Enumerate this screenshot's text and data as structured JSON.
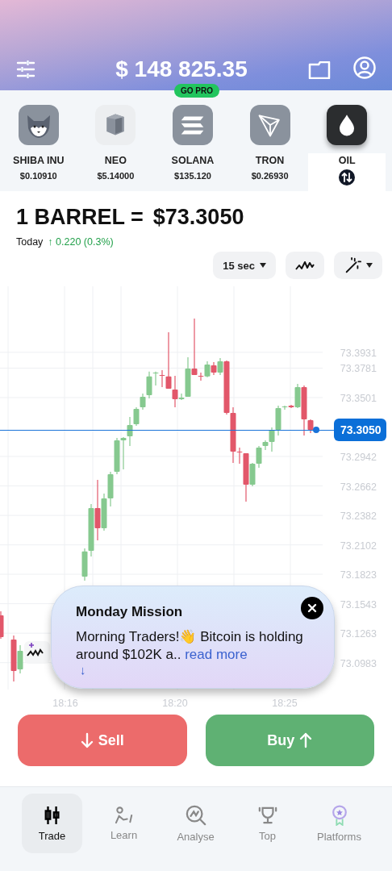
{
  "header": {
    "balance": "$ 148 825.35",
    "badge": "GO PRO"
  },
  "assets": [
    {
      "name": "SHIBA INU",
      "price": "$0.10910",
      "selected": false
    },
    {
      "name": "NEO",
      "price": "$5.14000",
      "selected": false
    },
    {
      "name": "SOLANA",
      "price": "$135.120",
      "selected": false
    },
    {
      "name": "TRON",
      "price": "$0.26930",
      "selected": false
    },
    {
      "name": "OIL",
      "selected": true
    }
  ],
  "quote": {
    "unit": "1 BARREL =",
    "price": "$73.3050",
    "period": "Today",
    "change": "↑ 0.220 (0.3%)"
  },
  "controls": {
    "interval": "15 sec"
  },
  "chart": {
    "current_price": "73.3050",
    "chart_data": {
      "type": "candlestick",
      "categories": [
        null,
        null,
        null,
        null,
        null,
        null,
        null,
        null,
        null,
        null,
        "18:16",
        null,
        null,
        null,
        null,
        null,
        null,
        null,
        null,
        null,
        null,
        null,
        null,
        null,
        null,
        null,
        null,
        "18:20",
        null,
        null,
        null,
        null,
        null,
        null,
        null,
        null,
        null,
        null,
        null,
        null,
        null,
        null,
        null,
        null,
        "18:25",
        null,
        null,
        null,
        null
      ],
      "ohlc": [
        [
          73.1433,
          73.1471,
          73.1211,
          73.1226
        ],
        null,
        [
          73.1203,
          73.1241,
          73.0805,
          73.0904
        ],
        [
          73.092,
          73.1149,
          73.0881,
          73.1096
        ],
        null,
        null,
        null,
        null,
        null,
        null,
        null,
        null,
        null,
        [
          73.18,
          73.2069,
          73.1762,
          73.2039
        ],
        [
          73.2046,
          73.249,
          73.1992,
          73.2452
        ],
        [
          73.2452,
          73.272,
          73.2145,
          73.226
        ],
        [
          73.226,
          73.2589,
          73.2237,
          73.2543
        ],
        [
          73.2543,
          73.2796,
          73.2467,
          73.2773
        ],
        [
          73.2796,
          73.3118,
          73.2773,
          73.3095
        ],
        [
          73.3095,
          73.3126,
          73.2819,
          73.3118
        ],
        [
          73.3133,
          73.3317,
          73.3041,
          73.3241
        ],
        [
          73.3248,
          73.3409,
          73.3233,
          73.3394
        ],
        [
          73.3409,
          73.3539,
          73.3386,
          73.3509
        ],
        [
          73.3524,
          73.3748,
          73.3493,
          73.3702
        ],
        [
          73.3731,
          73.3748,
          73.3616,
          73.3738
        ],
        [
          73.3715,
          73.3761,
          73.3601,
          73.3708
        ],
        [
          73.3702,
          73.4121,
          73.3585,
          73.3585
        ],
        [
          73.3578,
          73.3708,
          73.3409,
          73.3486
        ],
        [
          73.3486,
          73.3539,
          73.3478,
          73.3501
        ],
        [
          73.3509,
          73.3884,
          73.3509,
          73.3777
        ],
        [
          73.3777,
          73.4252,
          73.3715,
          73.3715
        ],
        [
          73.3708,
          73.3738,
          73.3662,
          73.3702
        ],
        [
          73.3702,
          73.3846,
          73.3694,
          73.3815
        ],
        [
          73.3807,
          73.3838,
          73.3715,
          73.3738
        ],
        [
          73.3738,
          73.3876,
          73.3715,
          73.3846
        ],
        [
          73.3846,
          73.3853,
          73.334,
          73.3355
        ],
        [
          73.3355,
          73.3409,
          73.2881,
          73.2988
        ],
        [
          73.2988,
          73.3026,
          73.2873,
          73.298
        ],
        [
          73.2972,
          73.2972,
          73.2513,
          73.2674
        ],
        [
          73.2674,
          73.2881,
          73.2659,
          73.2873
        ],
        [
          73.2873,
          73.3041,
          73.2835,
          73.3026
        ],
        [
          73.3041,
          73.3095,
          73.3003,
          73.308
        ],
        [
          73.308,
          73.3218,
          73.2988,
          73.3195
        ],
        [
          73.3195,
          73.3424,
          73.3141,
          73.3401
        ],
        [
          73.3409,
          73.3424,
          73.3386,
          73.3417
        ],
        [
          73.3424,
          73.3432,
          73.3401,
          73.3409
        ],
        [
          73.3409,
          73.3631,
          73.3401,
          73.3601
        ],
        [
          73.3601,
          73.3616,
          73.3141,
          73.3294
        ],
        [
          73.3286,
          73.3294,
          73.3164,
          73.3195
        ]
      ],
      "yticks": [
        {
          "value": 73.3931,
          "label": "73.3931"
        },
        {
          "value": 73.3781,
          "label": "73.3781"
        },
        {
          "value": 73.3501,
          "label": "73.3501"
        },
        {
          "value": 73.2942,
          "label": "73.2942"
        },
        {
          "value": 73.2662,
          "label": "73.2662"
        },
        {
          "value": 73.2382,
          "label": "73.2382"
        },
        {
          "value": 73.2102,
          "label": "73.2102"
        },
        {
          "value": 73.1823,
          "label": "73.1823"
        },
        {
          "value": 73.1543,
          "label": "73.1543"
        },
        {
          "value": 73.1263,
          "label": "73.1263"
        },
        {
          "value": 73.0983,
          "label": "73.0983"
        }
      ],
      "ylim": [
        73.0728,
        73.4558
      ],
      "grid": true
    }
  },
  "popup": {
    "title": "Monday Mission",
    "text": "Morning Traders!👋 Bitcoin is holding around $102K a..",
    "link": "read more",
    "arrow": "↓"
  },
  "actions": [
    {
      "label": "Sell",
      "kind": "sell"
    },
    {
      "label": "Buy",
      "kind": "buy"
    }
  ],
  "nav": [
    {
      "label": "Trade",
      "selected": true
    },
    {
      "label": "Learn",
      "selected": false
    },
    {
      "label": "Analyse",
      "selected": false
    },
    {
      "label": "Top",
      "selected": false
    },
    {
      "label": "Platforms",
      "selected": false
    }
  ]
}
